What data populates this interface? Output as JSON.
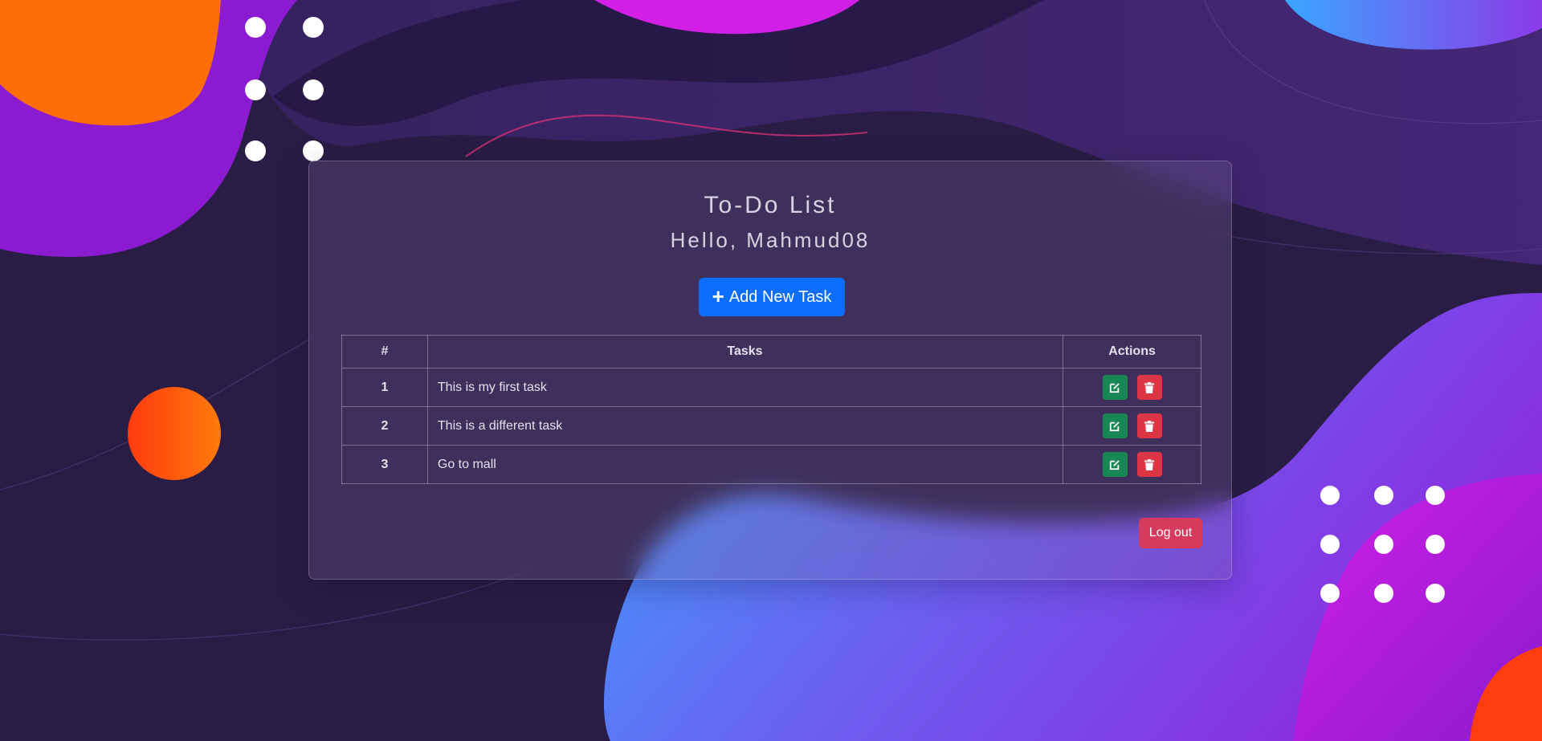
{
  "page": {
    "title": "To-Do List",
    "greeting": "Hello, Mahmud08"
  },
  "toolbar": {
    "add_label": "Add New Task",
    "add_icon": "plus-icon"
  },
  "table": {
    "headers": [
      "#",
      "Tasks",
      "Actions"
    ],
    "rows": [
      {
        "num": "1",
        "task": "This is my first task"
      },
      {
        "num": "2",
        "task": "This is a different task"
      },
      {
        "num": "3",
        "task": "Go to mall"
      }
    ],
    "actions": [
      {
        "name": "edit",
        "icon": "pen-square-icon",
        "color": "#198754"
      },
      {
        "name": "delete",
        "icon": "trash-icon",
        "color": "#dc3545"
      }
    ]
  },
  "footer": {
    "logout_label": "Log out"
  },
  "colors": {
    "primary": "#0d6efd",
    "success": "#198754",
    "danger": "#dc3545",
    "logout": "#d63a5c",
    "background": "#2a1d45"
  }
}
